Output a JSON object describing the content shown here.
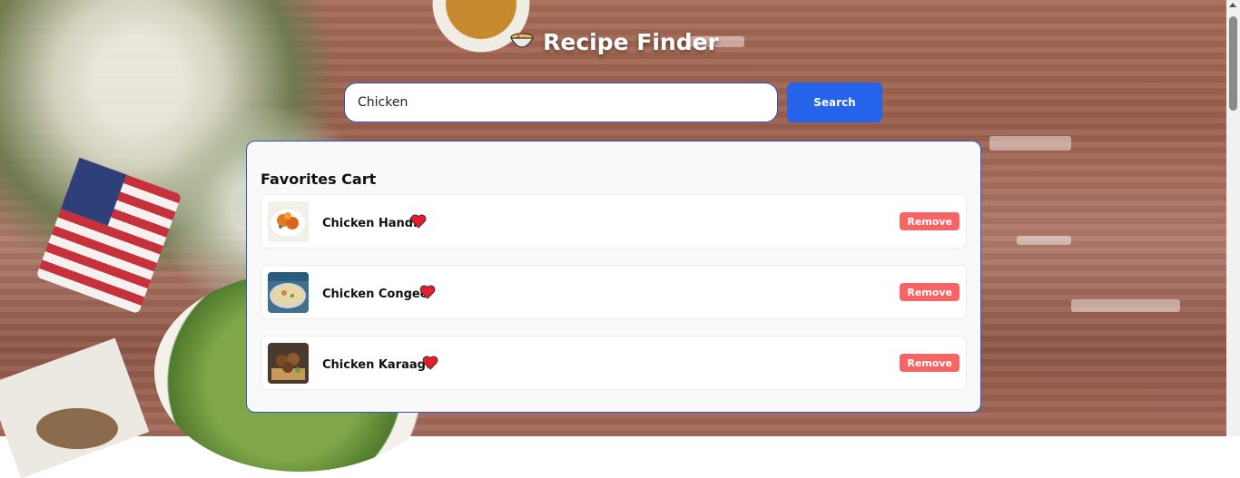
{
  "header": {
    "title": "Recipe Finder",
    "icon": "bowl-icon"
  },
  "search": {
    "value": "Chicken",
    "button_label": "Search"
  },
  "favorites": {
    "title": "Favorites Cart",
    "remove_label": "Remove",
    "items": [
      {
        "name": "Chicken Handi",
        "icon": "heart-icon"
      },
      {
        "name": "Chicken Congee",
        "icon": "heart-icon"
      },
      {
        "name": "Chicken Karaage",
        "icon": "heart-icon"
      }
    ]
  },
  "colors": {
    "accent": "#2563eb",
    "remove": "#f56565",
    "heart": "#e11d2e",
    "card_border": "#2b55c7"
  }
}
